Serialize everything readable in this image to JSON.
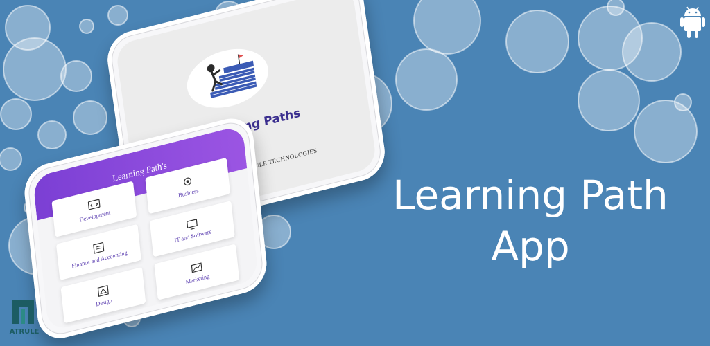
{
  "headline": {
    "line1": "Learning Path",
    "line2": "App"
  },
  "splash_screen": {
    "title": "Learning Paths",
    "company_name": "ATRULE TECHNOLOGIES",
    "company_mark_text": "ATRULE"
  },
  "categories_screen": {
    "header_title": "Learning Path's",
    "categories": [
      {
        "label": "Development",
        "icon": "development-icon"
      },
      {
        "label": "Business",
        "icon": "business-icon"
      },
      {
        "label": "Finance and Accounting",
        "icon": "finance-icon"
      },
      {
        "label": "IT and Software",
        "icon": "it-software-icon"
      },
      {
        "label": "Design",
        "icon": "design-icon"
      },
      {
        "label": "Marketing",
        "icon": "marketing-icon"
      }
    ]
  },
  "brand": {
    "text": "ATRULE"
  },
  "colors": {
    "background": "#4a84b5",
    "header_gradient_start": "#7b3fd4",
    "header_gradient_end": "#9b55e3",
    "label_purple": "#5b3eb0",
    "title_navy": "#3b2f8f",
    "brand_teal": "#1c5c63"
  }
}
